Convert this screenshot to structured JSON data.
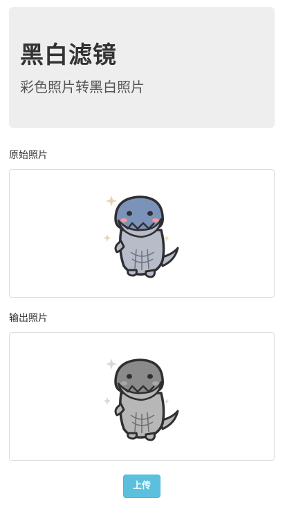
{
  "hero": {
    "title": "黑白滤镜",
    "subtitle": "彩色照片转黑白照片"
  },
  "original": {
    "label": "原始照片",
    "image_icon": "dinosaur-sticker-color"
  },
  "output": {
    "label": "输出照片",
    "image_icon": "dinosaur-sticker-grayscale"
  },
  "actions": {
    "upload_label": "上传"
  },
  "colors": {
    "hero_bg": "#eeeeee",
    "button_bg": "#5bc0de",
    "head_color": "#7b93b8",
    "body_color": "#b8bcc8",
    "cheek_color": "#f29a9a",
    "gray_head": "#8a8a8a",
    "gray_body": "#b7b7b7",
    "sparkle": "#e8dcc0"
  }
}
